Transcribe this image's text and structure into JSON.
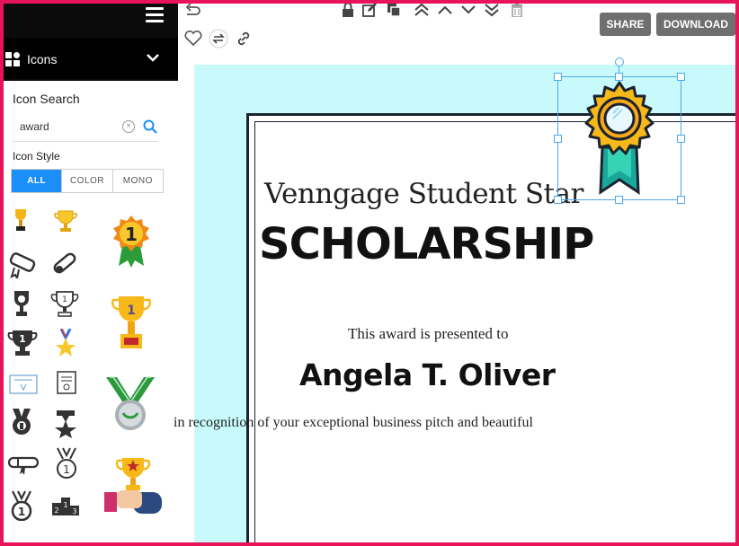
{
  "panel": {
    "section_title": "Icons",
    "search_label": "Icon Search",
    "search_value": "award",
    "style_label": "Icon Style",
    "style_options": [
      "ALL",
      "COLOR",
      "MONO"
    ],
    "active_style": "ALL"
  },
  "results": [
    "trophy-gold-small-icon",
    "trophy-outline-icon",
    "medal-number-one-icon",
    "diploma-scroll-icon",
    "diploma-ribbon-icon",
    "trophy-dark-icon",
    "trophy-number-one-outline-icon",
    "trophy-gold-number-one-icon",
    "trophy-number-one-dark-icon",
    "medal-star-icon",
    "certificate-icon",
    "certificate-document-icon",
    "medal-silver-wreath-icon",
    "medal-dark-icon",
    "medal-star-dark-icon",
    "diploma-dark-icon",
    "medal-number-one-outline-icon",
    "hand-holding-trophy-icon",
    "medal-number-one-dark-icon",
    "podium-icon"
  ],
  "toolbar": {
    "share_label": "SHARE",
    "download_label": "DOWNLOAD"
  },
  "certificate": {
    "subtitle": "Venngage Student Star",
    "title": "SCHOLARSHIP",
    "presented": "This award is presented to",
    "name": "Angela T. Oliver",
    "recognition": "in recognition of your exceptional business pitch and beautiful"
  },
  "colors": {
    "accent": "#1b8ef8",
    "frame": "#e8145a",
    "canvas": "#c8fafb",
    "button": "#6f6f6f"
  }
}
